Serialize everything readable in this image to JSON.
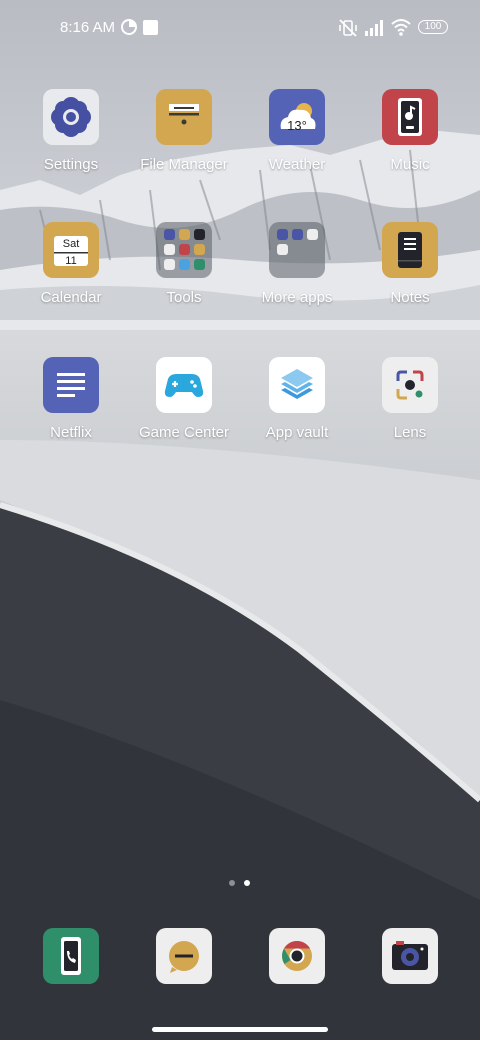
{
  "status_bar": {
    "time": "8:16 AM",
    "battery": "100",
    "icons": [
      "data-saver-icon",
      "square-notification-icon",
      "vibrate-off-icon",
      "signal-icon",
      "wifi-icon",
      "battery-icon"
    ]
  },
  "home": {
    "apps": [
      {
        "label": "Settings",
        "icon": "gear-flower-icon",
        "color": "#e9eaee"
      },
      {
        "label": "File Manager",
        "icon": "folder-drawer-icon",
        "color": "#d3a650"
      },
      {
        "label": "Weather",
        "icon": "cloud-sun-icon",
        "color": "#5563b6",
        "temp": "13°"
      },
      {
        "label": "Music",
        "icon": "music-player-icon",
        "color": "#c0444a"
      },
      {
        "label": "Calendar",
        "icon": "calendar-icon",
        "color": "#d3a650",
        "day": "Sat",
        "date": "11"
      },
      {
        "label": "Tools",
        "icon": "tools-folder-icon"
      },
      {
        "label": "More apps",
        "icon": "more-apps-folder-icon"
      },
      {
        "label": "Notes",
        "icon": "notebook-icon",
        "color": "#d3a650"
      },
      {
        "label": "Netflix",
        "icon": "text-lines-icon",
        "color": "#5563b6"
      },
      {
        "label": "Game Center",
        "icon": "gamepad-icon",
        "color": "#ffffff"
      },
      {
        "label": "App vault",
        "icon": "layers-icon",
        "color": "#ffffff"
      },
      {
        "label": "Lens",
        "icon": "lens-icon",
        "color": "#eeeeee"
      }
    ],
    "page_indicator": {
      "pages": 2,
      "current": 2
    }
  },
  "dock": [
    {
      "name": "phone",
      "icon": "phone-icon",
      "color": "#2f8f6b"
    },
    {
      "name": "messages",
      "icon": "message-bubble-icon",
      "color": "#eeeeee"
    },
    {
      "name": "chrome",
      "icon": "chrome-icon",
      "color": "#eeeeee"
    },
    {
      "name": "camera",
      "icon": "camera-icon",
      "color": "#eeeeee"
    }
  ]
}
